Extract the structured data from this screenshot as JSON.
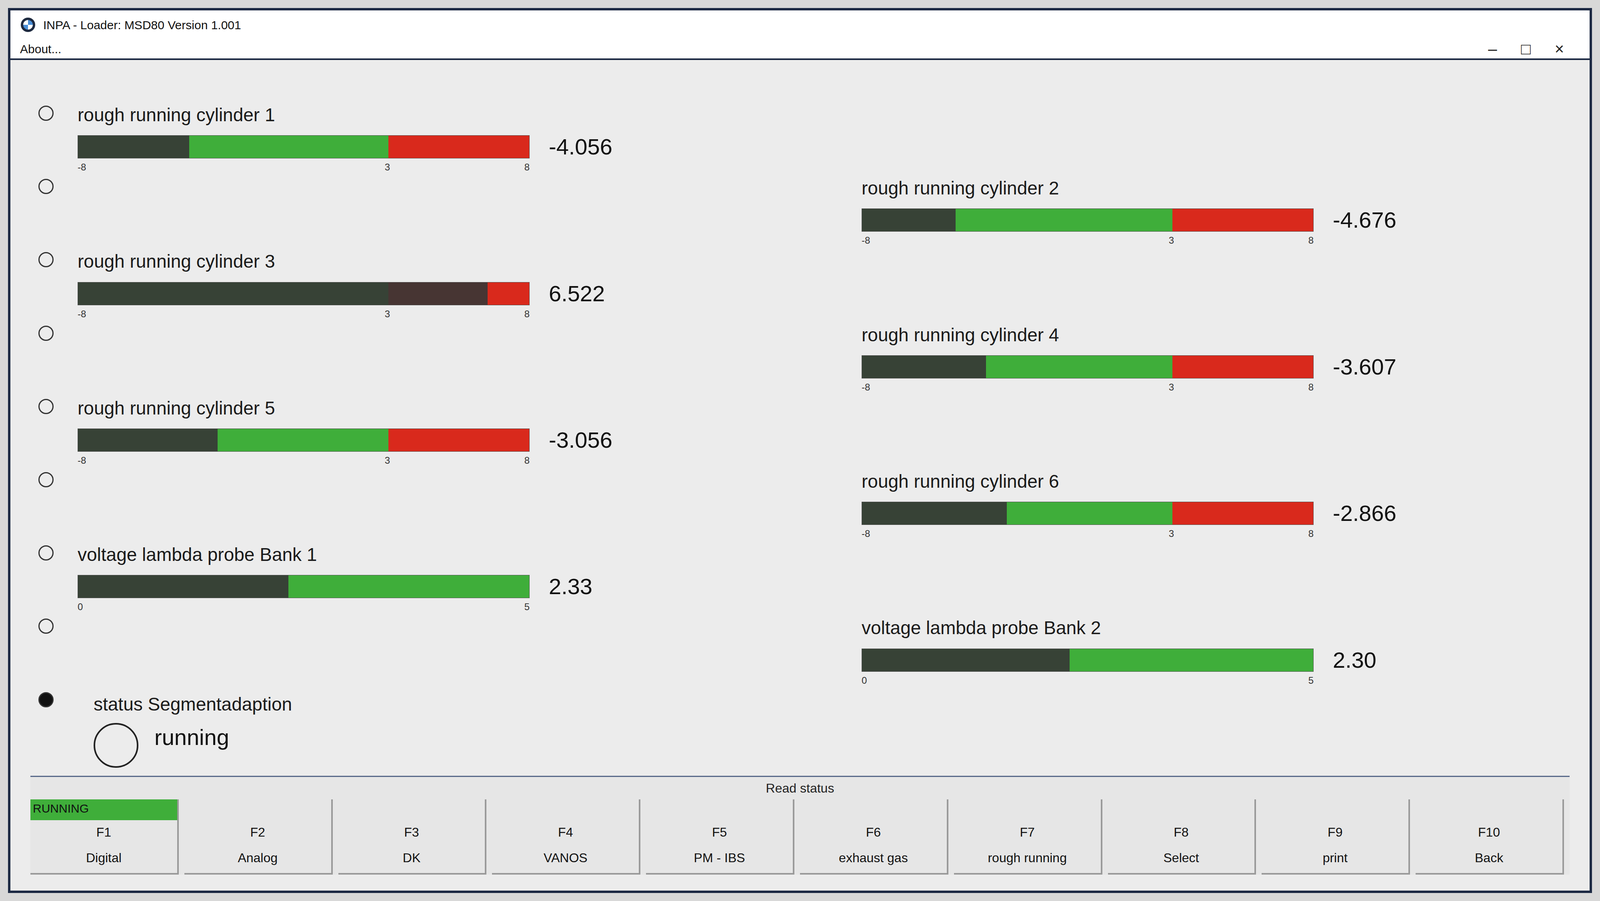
{
  "window": {
    "title": "INPA - Loader: MSD80 Version 1.001",
    "controls": [
      "–",
      "□",
      "×"
    ]
  },
  "menu": [
    "About..."
  ],
  "gauges": [
    {
      "kind": "rough-running",
      "label": "rough running cylinder 1",
      "level": 0.2465,
      "reading": "-4.056",
      "ticks": [
        "-8",
        "3",
        "8"
      ],
      "selected": false
    },
    {
      "kind": "rough-running",
      "label": "rough running cylinder 2",
      "level": 0.2078,
      "reading": "-4.676",
      "ticks": [
        "-8",
        "3",
        "8"
      ],
      "selected": false
    },
    {
      "kind": "rough-running",
      "label": "rough running cylinder 3",
      "level": 0.9076,
      "reading": "6.522",
      "ticks": [
        "-8",
        "3",
        "8"
      ],
      "selected": false
    },
    {
      "kind": "rough-running",
      "label": "rough running cylinder 4",
      "level": 0.2746,
      "reading": "-3.607",
      "ticks": [
        "-8",
        "3",
        "8"
      ],
      "selected": false
    },
    {
      "kind": "rough-running",
      "label": "rough running cylinder 5",
      "level": 0.309,
      "reading": "-3.056",
      "ticks": [
        "-8",
        "3",
        "8"
      ],
      "selected": false
    },
    {
      "kind": "rough-running",
      "label": "rough running cylinder 6",
      "level": 0.3209,
      "reading": "-2.866",
      "ticks": [
        "-8",
        "3",
        "8"
      ],
      "selected": false
    },
    {
      "kind": "lambda",
      "label": "voltage lambda probe Bank 1",
      "level": 0.466,
      "reading": "2.33",
      "ticks": [
        "0",
        "5"
      ],
      "selected": false
    },
    {
      "kind": "lambda",
      "label": "voltage lambda probe Bank 2",
      "level": 0.46,
      "reading": "2.30",
      "ticks": [
        "0",
        "5"
      ],
      "selected": false
    }
  ],
  "status": {
    "label": "status Segmentadaption",
    "value": "running",
    "indicator_on": false,
    "selected": true
  },
  "footer": {
    "caption": "Read status",
    "state": "RUNNING",
    "keys": [
      {
        "key": "F1",
        "label": "Digital",
        "selected": false
      },
      {
        "key": "F2",
        "label": "Analog",
        "selected": false
      },
      {
        "key": "F3",
        "label": "DK",
        "selected": false
      },
      {
        "key": "F4",
        "label": "VANOS",
        "selected": false
      },
      {
        "key": "F5",
        "label": "PM - IBS",
        "selected": false
      },
      {
        "key": "F6",
        "label": "exhaust gas",
        "selected": false
      },
      {
        "key": "F7",
        "label": "rough running",
        "selected": false
      },
      {
        "key": "F8",
        "label": "Select",
        "selected": false
      },
      {
        "key": "F9",
        "label": "print",
        "selected": false
      },
      {
        "key": "F10",
        "label": "Back",
        "selected": false
      }
    ]
  }
}
